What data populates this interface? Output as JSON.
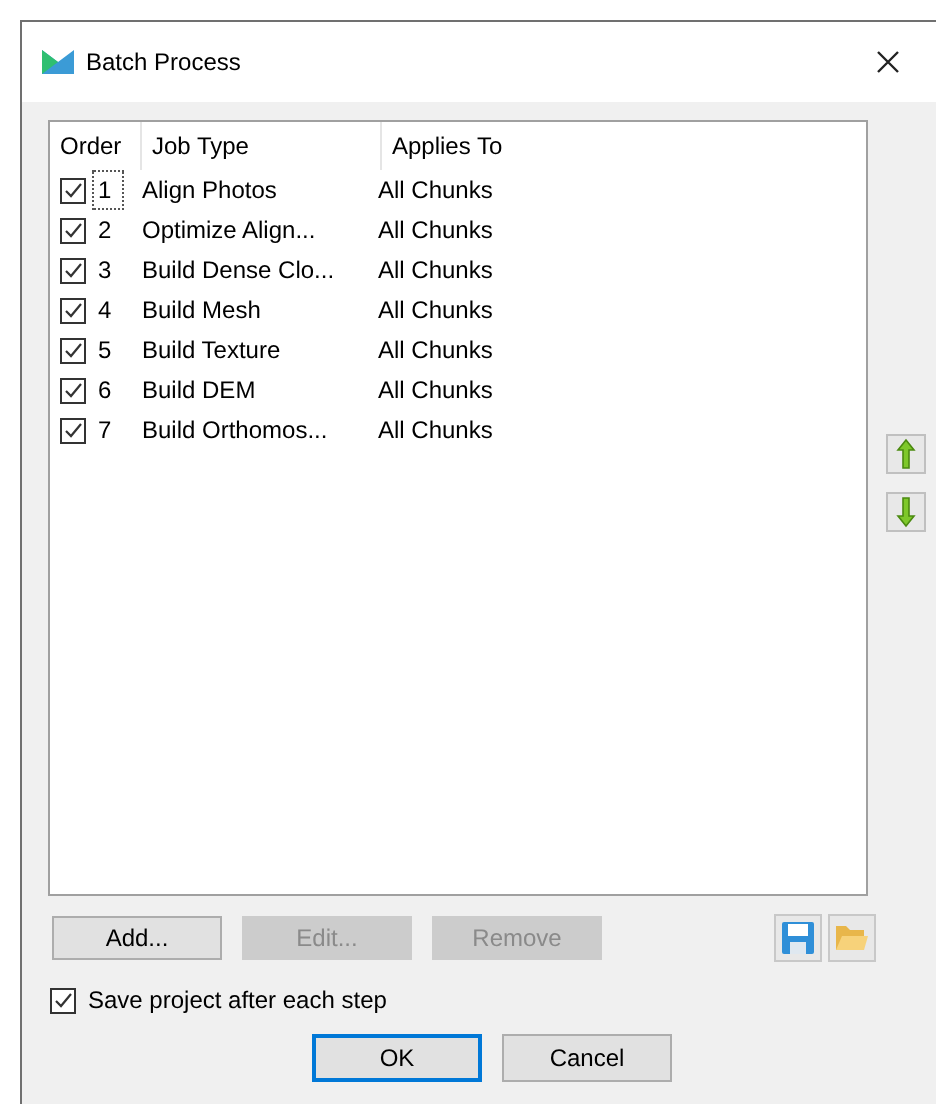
{
  "window": {
    "title": "Batch Process"
  },
  "table": {
    "columns": [
      "Order",
      "Job Type",
      "Applies To"
    ],
    "rows": [
      {
        "checked": true,
        "focused": true,
        "order": "1",
        "job_type": "Align Photos",
        "applies_to": "All Chunks"
      },
      {
        "checked": true,
        "focused": false,
        "order": "2",
        "job_type": "Optimize Align...",
        "applies_to": "All Chunks"
      },
      {
        "checked": true,
        "focused": false,
        "order": "3",
        "job_type": "Build Dense Clo...",
        "applies_to": "All Chunks"
      },
      {
        "checked": true,
        "focused": false,
        "order": "4",
        "job_type": "Build Mesh",
        "applies_to": "All Chunks"
      },
      {
        "checked": true,
        "focused": false,
        "order": "5",
        "job_type": "Build Texture",
        "applies_to": "All Chunks"
      },
      {
        "checked": true,
        "focused": false,
        "order": "6",
        "job_type": "Build DEM",
        "applies_to": "All Chunks"
      },
      {
        "checked": true,
        "focused": false,
        "order": "7",
        "job_type": "Build Orthomos...",
        "applies_to": "All Chunks"
      }
    ]
  },
  "buttons": [
    {
      "label": "Add...",
      "disabled": false
    },
    {
      "label": "Edit...",
      "disabled": true
    },
    {
      "label": "Remove",
      "disabled": true
    }
  ],
  "save_project_option": {
    "label": "Save project after each step",
    "checked": true
  },
  "dialog_buttons": [
    {
      "label": "OK",
      "default": true
    },
    {
      "label": "Cancel",
      "default": false
    }
  ]
}
